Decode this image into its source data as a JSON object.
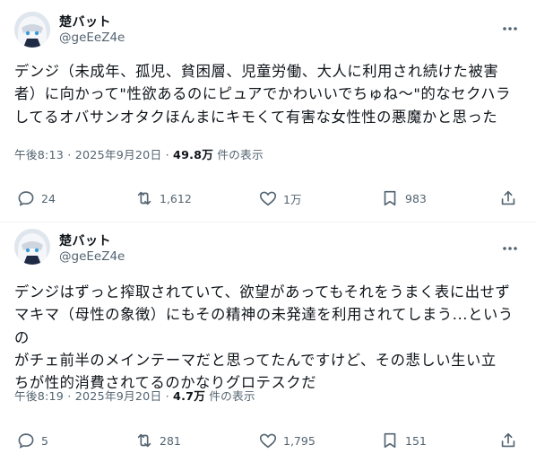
{
  "tweets": [
    {
      "display_name": "楚バット",
      "handle": "@geEeZ4e",
      "text": "デンジ（未成年、孤児、貧困層、児童労働、大人に利用され続けた被害\n者）に向かって\"性欲あるのにピュアでかわいいでちゅね〜\"的なセクハラ\nしてるオバサンオタクほんまにキモくて有害な女性性の悪魔かと思った",
      "time": "午後8:13 · 2025年9月20日 · ",
      "views": "49.8万",
      "views_suffix": " 件の表示",
      "replies": "24",
      "retweets": "1,612",
      "likes": "1万",
      "bookmarks": "983"
    },
    {
      "display_name": "楚バット",
      "handle": "@geEeZ4e",
      "text": "デンジはずっと搾取されていて、欲望があってもそれをうまく表に出せず\nマキマ（母性の象徴）にもその精神の未発達を利用されてしまう...というの\nがチェ前半のメインテーマだと思ってたんですけど、その悲しい生い立\nちが性的消費されてるのかなりグロテスクだ",
      "time": "午後8:19 · 2025年9月20日 · ",
      "views": "4.7万",
      "views_suffix": " 件の表示",
      "replies": "5",
      "retweets": "281",
      "likes": "1,795",
      "bookmarks": "151"
    }
  ],
  "icons": {
    "more": "more-icon",
    "reply": "reply-icon",
    "retweet": "retweet-icon",
    "like": "heart-icon",
    "bookmark": "bookmark-icon",
    "share": "share-icon"
  },
  "colors": {
    "text": "#0f1419",
    "secondary": "#536471",
    "divider": "#eff3f4"
  }
}
